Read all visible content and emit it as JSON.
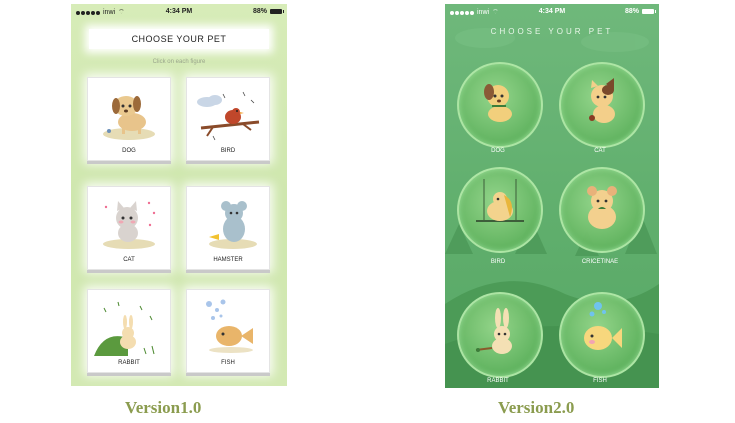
{
  "v1": {
    "status": {
      "carrier": "inwi",
      "time": "4:34 PM",
      "battery": "88%"
    },
    "title": "CHOOSE YOUR PET",
    "subtitle": "Click on each figure",
    "pets": [
      {
        "label": "DOG"
      },
      {
        "label": "BIRD"
      },
      {
        "label": "CAT"
      },
      {
        "label": "HAMSTER"
      },
      {
        "label": "RABBIT"
      },
      {
        "label": "FISH"
      }
    ],
    "caption": "Version1.0"
  },
  "v2": {
    "status": {
      "carrier": "inwi",
      "time": "4:34 PM",
      "battery": "88%"
    },
    "title": "CHOOSE YOUR PET",
    "pets": [
      {
        "label": "DOG"
      },
      {
        "label": "CAT"
      },
      {
        "label": "BIRD"
      },
      {
        "label": "CRICETINAE"
      },
      {
        "label": "RABBIT"
      },
      {
        "label": "FISH"
      }
    ],
    "caption": "Version2.0"
  },
  "colors": {
    "caption": "#8b9c4f",
    "v1_bg": "#d3e9b3",
    "v2_bg": "#5fae6c"
  }
}
